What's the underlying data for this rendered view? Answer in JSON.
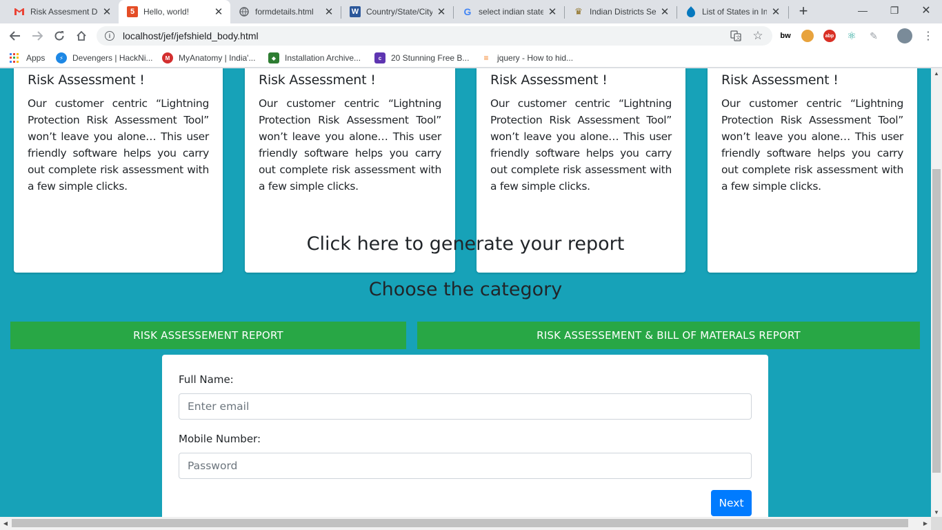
{
  "browser": {
    "tabs": [
      {
        "title": "Risk Assesment De",
        "icon": "gmail-icon",
        "active": false
      },
      {
        "title": "Hello, world!",
        "icon": "html5-icon",
        "active": true
      },
      {
        "title": "formdetails.html",
        "icon": "globe-icon",
        "active": false
      },
      {
        "title": "Country/State/City",
        "icon": "word-icon",
        "active": false
      },
      {
        "title": "select indian state",
        "icon": "google-icon",
        "active": false
      },
      {
        "title": "Indian Districts Sel",
        "icon": "emblem-icon",
        "active": false
      },
      {
        "title": "List of States in Inc",
        "icon": "drupal-icon",
        "active": false
      }
    ],
    "new_tab": "+",
    "window_controls": {
      "minimize": "—",
      "restore": "❐",
      "close": "✕"
    },
    "url": "localhost/jef/jefshield_body.html",
    "bookmarks": [
      {
        "label": "Apps",
        "icon": "apps-grid-icon"
      },
      {
        "label": "Devengers | HackNi...",
        "icon": "devengers-icon"
      },
      {
        "label": "MyAnatomy | India'...",
        "icon": "myanatomy-icon"
      },
      {
        "label": "Installation Archive...",
        "icon": "installation-icon"
      },
      {
        "label": "20 Stunning Free B...",
        "icon": "colorlib-icon"
      },
      {
        "label": "jquery - How to hid...",
        "icon": "stackoverflow-icon"
      }
    ],
    "extensions": [
      "bw",
      "abp"
    ]
  },
  "page": {
    "cards": [
      {
        "title": "Risk Assessment !",
        "body": "Our customer centric “Lightning Protection Risk Assessment Tool” won’t leave you alone… This user friendly software helps you carry out complete risk assessment with a few simple clicks."
      },
      {
        "title": "Risk Assessment !",
        "body": "Our customer centric “Lightning Protection Risk Assessment Tool” won’t leave you alone… This user friendly software helps you carry out complete risk assessment with a few simple clicks."
      },
      {
        "title": "Risk Assessment !",
        "body": "Our customer centric “Lightning Protection Risk Assessment Tool” won’t leave you alone… This user friendly software helps you carry out complete risk assessment with a few simple clicks."
      },
      {
        "title": "Risk Assessment !",
        "body": "Our customer centric “Lightning Protection Risk Assessment Tool” won’t leave you alone… This user friendly software helps you carry out complete risk assessment with a few simple clicks."
      }
    ],
    "generate_heading": "Click here to generate your report",
    "category_heading": "Choose the category",
    "category_buttons": [
      {
        "label": "RISK ASSESSEMENT REPORT"
      },
      {
        "label": "RISK ASSESSEMENT & BILL OF MATERALS REPORT"
      }
    ],
    "form": {
      "full_name_label": "Full Name:",
      "full_name_placeholder": "Enter email",
      "mobile_label": "Mobile Number:",
      "mobile_placeholder": "Password",
      "next_label": "Next"
    }
  },
  "colors": {
    "page_bg": "#17a2b8",
    "success": "#28a745",
    "primary": "#007bff"
  }
}
